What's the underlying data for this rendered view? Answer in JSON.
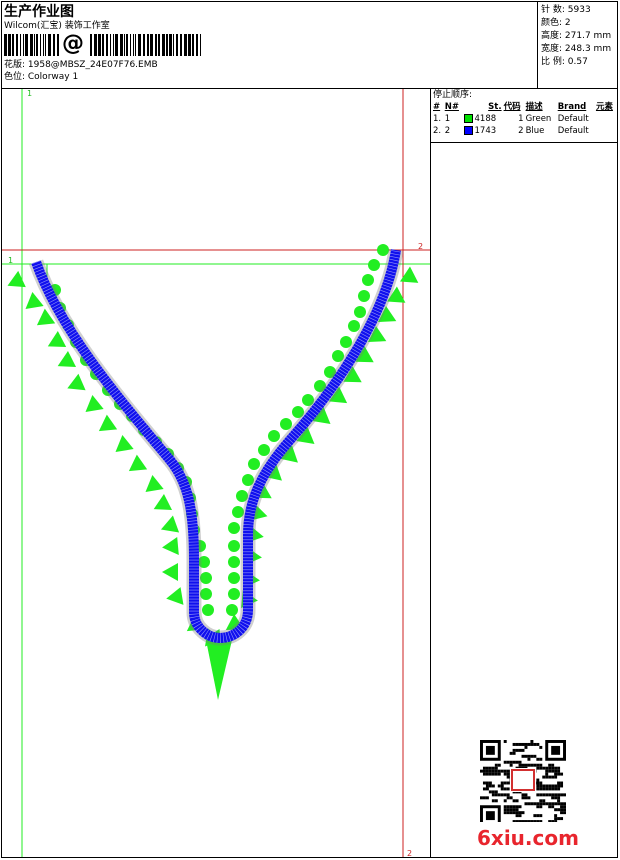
{
  "header": {
    "title": "生产作业图",
    "company": "Wilcom(汇宝) 装饰工作室",
    "barcode_symbol": "@",
    "design_line": "花版: 1958@MBSZ_24E07F76.EMB",
    "colorway_line": "色位: Colorway 1"
  },
  "stats": [
    {
      "label": "针 数:",
      "value": "5933"
    },
    {
      "label": "颜色:",
      "value": "2"
    },
    {
      "label": "高度:",
      "value": "271.7 mm"
    },
    {
      "label": "宽度:",
      "value": "248.3 mm"
    },
    {
      "label": "比 例:",
      "value": "0.57"
    }
  ],
  "stop_sequence": {
    "caption": "停止顺序:",
    "headers": [
      "#",
      "N#",
      "St.",
      "代码",
      "描述",
      "Brand",
      "元素"
    ],
    "rows": [
      {
        "idx": "1.",
        "n": "1",
        "st": "4188",
        "code": "1",
        "desc": "Green",
        "brand": "Default",
        "element": "",
        "color": "#00e000"
      },
      {
        "idx": "2.",
        "n": "2",
        "st": "1743",
        "code": "2",
        "desc": "Blue",
        "brand": "Default",
        "element": "",
        "color": "#0000ff"
      }
    ]
  },
  "design_labels": {
    "green_top": "1",
    "green_left": "1",
    "red_right": "2",
    "red_bottom": "2"
  },
  "design_colors": {
    "green": "#22ee22",
    "blue": "#1010ee",
    "red": "#cc2222"
  },
  "watermark": "6xiu.com",
  "qr_icon": "qr-code-icon"
}
